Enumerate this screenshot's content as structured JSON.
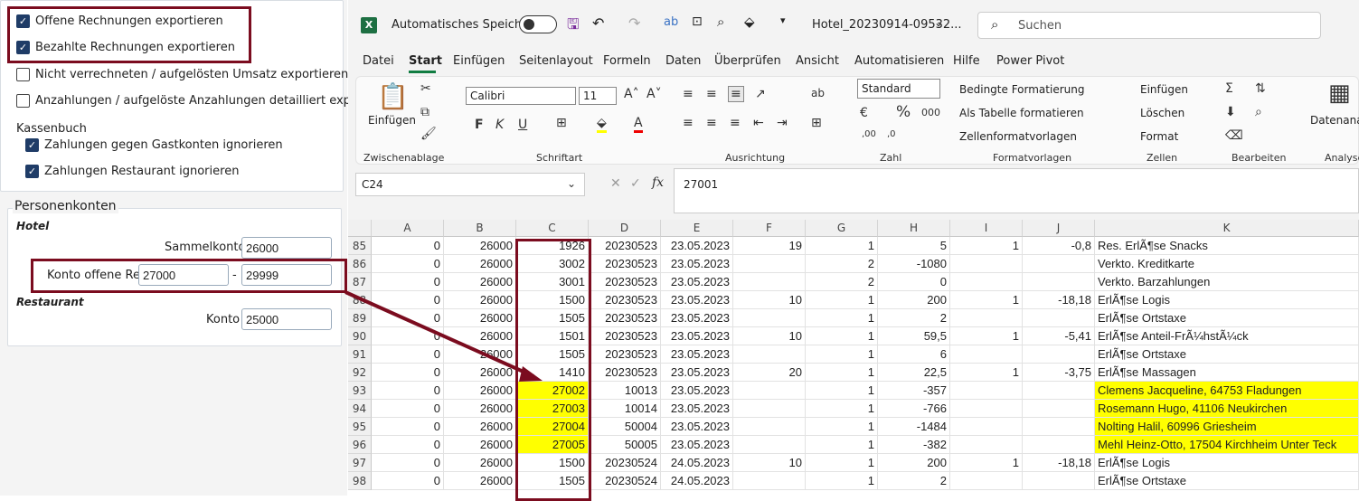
{
  "left": {
    "checks": [
      {
        "label": "Offene Rechnungen exportieren",
        "checked": true
      },
      {
        "label": "Bezahlte Rechnungen exportieren",
        "checked": true
      },
      {
        "label": "Nicht verrechneten / aufgelösten Umsatz exportieren",
        "checked": false
      },
      {
        "label": "Anzahlungen / aufgelöste Anzahlungen detailliert expor",
        "checked": false
      }
    ],
    "kassenbuch_title": "Kassenbuch",
    "kassenbuch_checks": [
      {
        "label": "Zahlungen gegen Gastkonten ignorieren",
        "checked": true
      },
      {
        "label": "Zahlungen Restaurant ignorieren",
        "checked": true
      }
    ],
    "personen_title": "Personenkonten",
    "hotel_title": "Hotel",
    "sammelkonto_label": "Sammelkonto",
    "sammelkonto_value": "26000",
    "offene_label": "Konto offene Re.",
    "offene_from": "27000",
    "dash": "-",
    "offene_to": "29999",
    "restaurant_title": "Restaurant",
    "konto_label": "Konto",
    "konto_value": "25000"
  },
  "excel": {
    "autosave": "Automatisches Speichern",
    "filename": "Hotel_20230914-09532...",
    "search": "Suchen",
    "tabs": [
      "Datei",
      "Start",
      "Einfügen",
      "Seitenlayout",
      "Formeln",
      "Daten",
      "Überprüfen",
      "Ansicht",
      "Automatisieren",
      "Hilfe",
      "Power Pivot"
    ],
    "ribbon": {
      "paste": "Einfügen",
      "font": "Calibri",
      "size": "11",
      "numfmt": "Standard",
      "cond": "Bedingte Formatierung",
      "table": "Als Tabelle formatieren",
      "cellstyles": "Zellenformatvorlagen",
      "insert": "Einfügen",
      "delete": "Löschen",
      "format": "Format",
      "datanal": "Datenanal",
      "groups": [
        "Zwischenablage",
        "Schriftart",
        "Ausrichtung",
        "Zahl",
        "Formatvorlagen",
        "Zellen",
        "Bearbeiten",
        "Analyse"
      ]
    },
    "namebox": "C24",
    "formula": "27001",
    "columns": [
      "A",
      "B",
      "C",
      "D",
      "E",
      "F",
      "G",
      "H",
      "I",
      "J",
      "K"
    ],
    "rows": [
      {
        "n": "85",
        "c": [
          "0",
          "26000",
          "1926",
          "20230523",
          "23.05.2023",
          "19",
          "1",
          "5",
          "1",
          "-0,8",
          "Res. ErlÃ¶se Snacks"
        ]
      },
      {
        "n": "86",
        "c": [
          "0",
          "26000",
          "3002",
          "20230523",
          "23.05.2023",
          "",
          "2",
          "-1080",
          "",
          "",
          "Verkto. Kreditkarte"
        ]
      },
      {
        "n": "87",
        "c": [
          "0",
          "26000",
          "3001",
          "20230523",
          "23.05.2023",
          "",
          "2",
          "0",
          "",
          "",
          "Verkto. Barzahlungen"
        ]
      },
      {
        "n": "88",
        "c": [
          "0",
          "26000",
          "1500",
          "20230523",
          "23.05.2023",
          "10",
          "1",
          "200",
          "1",
          "-18,18",
          "ErlÃ¶se Logis"
        ]
      },
      {
        "n": "89",
        "c": [
          "0",
          "26000",
          "1505",
          "20230523",
          "23.05.2023",
          "",
          "1",
          "2",
          "",
          "",
          "ErlÃ¶se Ortstaxe"
        ]
      },
      {
        "n": "90",
        "c": [
          "0",
          "26000",
          "1501",
          "20230523",
          "23.05.2023",
          "10",
          "1",
          "59,5",
          "1",
          "-5,41",
          "ErlÃ¶se Anteil-FrÃ¼hstÃ¼ck"
        ]
      },
      {
        "n": "91",
        "c": [
          "0",
          "26000",
          "1505",
          "20230523",
          "23.05.2023",
          "",
          "1",
          "6",
          "",
          "",
          "ErlÃ¶se Ortstaxe"
        ]
      },
      {
        "n": "92",
        "c": [
          "0",
          "26000",
          "1410",
          "20230523",
          "23.05.2023",
          "20",
          "1",
          "22,5",
          "1",
          "-3,75",
          "ErlÃ¶se Massagen"
        ]
      },
      {
        "n": "93",
        "c": [
          "0",
          "26000",
          "27002",
          "10013",
          "23.05.2023",
          "",
          "1",
          "-357",
          "",
          "",
          "Clemens Jacqueline, 64753 Fladungen"
        ],
        "hl": true
      },
      {
        "n": "94",
        "c": [
          "0",
          "26000",
          "27003",
          "10014",
          "23.05.2023",
          "",
          "1",
          "-766",
          "",
          "",
          "Rosemann Hugo, 41106 Neukirchen"
        ],
        "hl": true
      },
      {
        "n": "95",
        "c": [
          "0",
          "26000",
          "27004",
          "50004",
          "23.05.2023",
          "",
          "1",
          "-1484",
          "",
          "",
          "Nolting Halil, 60996 Griesheim"
        ],
        "hl": true
      },
      {
        "n": "96",
        "c": [
          "0",
          "26000",
          "27005",
          "50005",
          "23.05.2023",
          "",
          "1",
          "-382",
          "",
          "",
          "Mehl Heinz-Otto, 17504 Kirchheim Unter Teck"
        ],
        "hl": true
      },
      {
        "n": "97",
        "c": [
          "0",
          "26000",
          "1500",
          "20230524",
          "24.05.2023",
          "10",
          "1",
          "200",
          "1",
          "-18,18",
          "ErlÃ¶se Logis"
        ]
      },
      {
        "n": "98",
        "c": [
          "0",
          "26000",
          "1505",
          "20230524",
          "24.05.2023",
          "",
          "1",
          "2",
          "",
          "",
          "ErlÃ¶se Ortstaxe"
        ]
      }
    ]
  }
}
